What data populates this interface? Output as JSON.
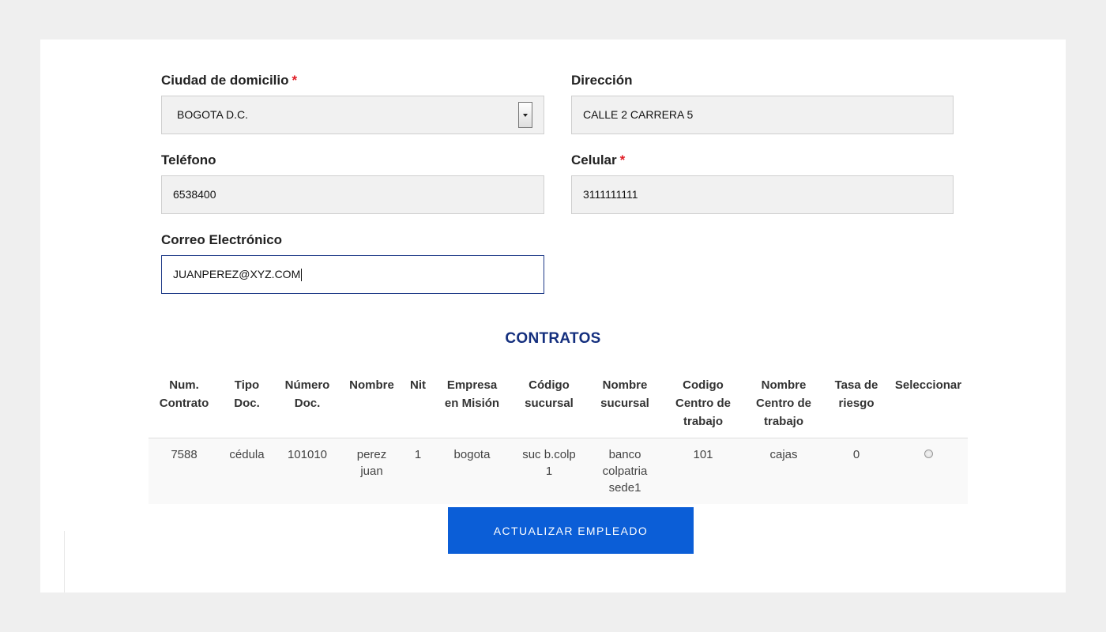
{
  "form": {
    "ciudad": {
      "label": "Ciudad de domicilio",
      "required": "*",
      "value": "BOGOTA D.C."
    },
    "direccion": {
      "label": "Dirección",
      "value": "CALLE 2 CARRERA 5"
    },
    "telefono": {
      "label": "Teléfono",
      "value": "6538400"
    },
    "celular": {
      "label": "Celular",
      "required": "*",
      "value": "3111111111"
    },
    "correo": {
      "label": "Correo Electrónico",
      "value": "JUANPEREZ@XYZ.COM"
    }
  },
  "contratos": {
    "title": "CONTRATOS",
    "headers": [
      [
        "Num.",
        "Contrato"
      ],
      [
        "Tipo",
        "Doc."
      ],
      [
        "Número",
        "Doc."
      ],
      [
        "Nombre"
      ],
      [
        "Nit"
      ],
      [
        "Empresa",
        "en Misión"
      ],
      [
        "Código",
        "sucursal"
      ],
      [
        "Nombre",
        "sucursal"
      ],
      [
        "Codigo",
        "Centro de",
        "trabajo"
      ],
      [
        "Nombre",
        "Centro de",
        "trabajo"
      ],
      [
        "Tasa de",
        "riesgo"
      ],
      [
        "Seleccionar"
      ]
    ],
    "rows": [
      [
        [
          "7588"
        ],
        [
          "cédula"
        ],
        [
          "101010"
        ],
        [
          "perez",
          "juan"
        ],
        [
          "1"
        ],
        [
          "bogota"
        ],
        [
          "suc b.colp",
          "1"
        ],
        [
          "banco",
          "colpatria",
          "sede1"
        ],
        [
          "101"
        ],
        [
          "cajas"
        ],
        [
          "0"
        ]
      ]
    ]
  },
  "actions": {
    "update_label": "ACTUALIZAR EMPLEADO"
  },
  "colors": {
    "accent": "#0b5ed7",
    "title": "#142f7e",
    "required": "#e01b24"
  }
}
